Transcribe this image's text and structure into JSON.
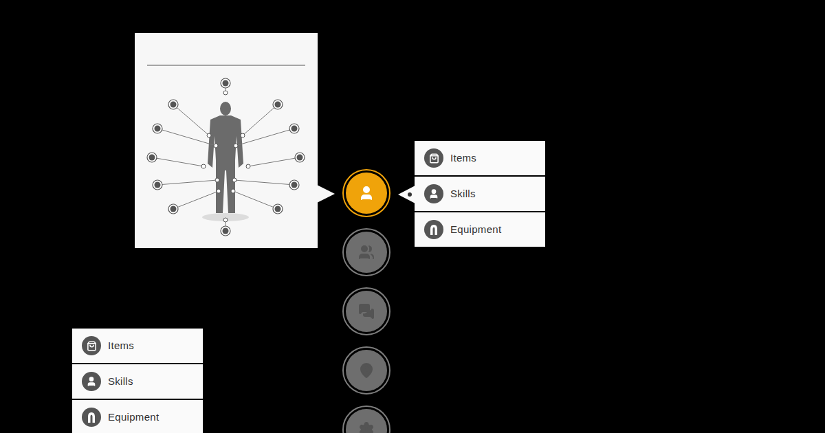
{
  "nav": [
    {
      "selected": true
    },
    {
      "selected": false
    },
    {
      "selected": false
    },
    {
      "selected": false
    },
    {
      "selected": false
    }
  ],
  "menus": [
    {
      "items": [
        {
          "label": "Items"
        },
        {
          "label": "Skills"
        },
        {
          "label": "Equipment"
        }
      ]
    },
    {
      "items": [
        {
          "label": "Items"
        },
        {
          "label": "Skills"
        },
        {
          "label": "Equipment"
        }
      ]
    }
  ]
}
